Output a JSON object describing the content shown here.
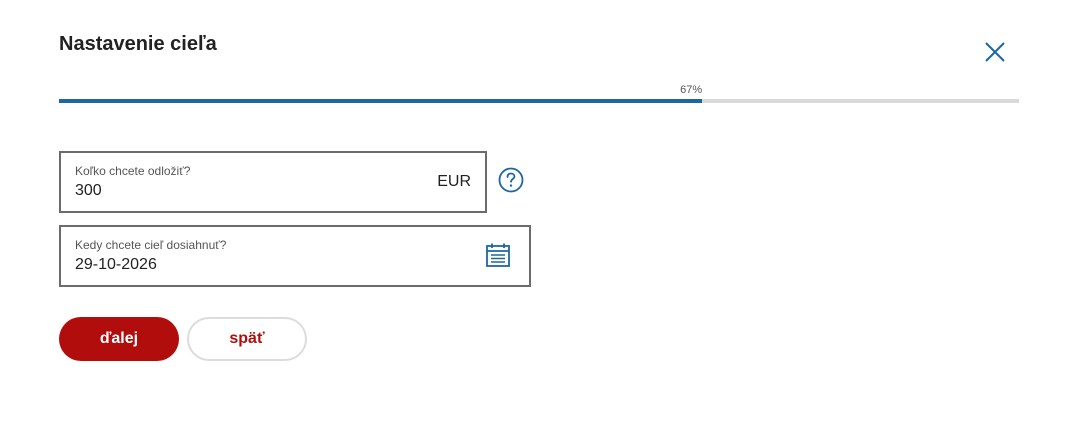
{
  "dialog": {
    "title": "Nastavenie cieľa"
  },
  "progress": {
    "label": "67%",
    "fraction": 0.67
  },
  "amount_field": {
    "label": "Koľko chcete odložiť?",
    "value": "300",
    "currency": "EUR"
  },
  "date_field": {
    "label": "Kedy chcete cieľ dosiahnuť?",
    "value": "29-10-2026"
  },
  "buttons": {
    "next": "ďalej",
    "back": "späť"
  },
  "icons": {
    "close": "close-icon",
    "help": "help-icon",
    "calendar": "calendar-icon"
  },
  "colors": {
    "accent": "#1d66a3",
    "primary_button": "#b20d0d"
  }
}
